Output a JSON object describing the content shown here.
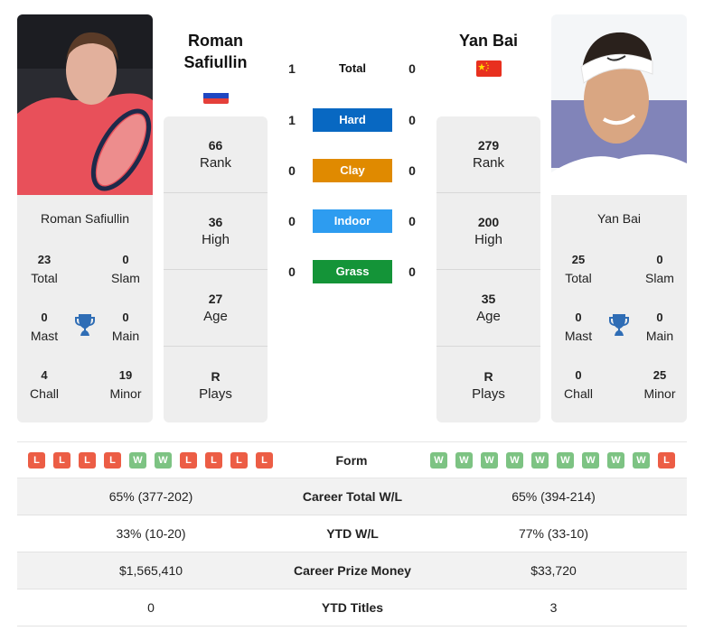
{
  "h2h": {
    "rows": [
      {
        "label": "Total",
        "p1": "1",
        "p2": "0",
        "color": ""
      },
      {
        "label": "Hard",
        "p1": "1",
        "p2": "0",
        "color": "#0868c2"
      },
      {
        "label": "Clay",
        "p1": "0",
        "p2": "0",
        "color": "#e08a00"
      },
      {
        "label": "Indoor",
        "p1": "0",
        "p2": "0",
        "color": "#2d9cf0"
      },
      {
        "label": "Grass",
        "p1": "0",
        "p2": "0",
        "color": "#149438"
      }
    ]
  },
  "player1": {
    "name_line1": "Roman",
    "name_line2": "Safiullin",
    "full_name": "Roman Safiullin",
    "flag": "russia-flag",
    "rank": {
      "value": "66",
      "label": "Rank"
    },
    "high": {
      "value": "36",
      "label": "High"
    },
    "age": {
      "value": "27",
      "label": "Age"
    },
    "plays": {
      "value": "R",
      "label": "Plays"
    },
    "titles": {
      "total": {
        "value": "23",
        "label": "Total"
      },
      "slam": {
        "value": "0",
        "label": "Slam"
      },
      "mast": {
        "value": "0",
        "label": "Mast"
      },
      "main": {
        "value": "0",
        "label": "Main"
      },
      "chall": {
        "value": "4",
        "label": "Chall"
      },
      "minor": {
        "value": "19",
        "label": "Minor"
      }
    },
    "form": [
      "L",
      "L",
      "L",
      "L",
      "W",
      "W",
      "L",
      "L",
      "L",
      "L"
    ]
  },
  "player2": {
    "name": "Yan Bai",
    "full_name": "Yan Bai",
    "flag": "china-flag",
    "rank": {
      "value": "279",
      "label": "Rank"
    },
    "high": {
      "value": "200",
      "label": "High"
    },
    "age": {
      "value": "35",
      "label": "Age"
    },
    "plays": {
      "value": "R",
      "label": "Plays"
    },
    "titles": {
      "total": {
        "value": "25",
        "label": "Total"
      },
      "slam": {
        "value": "0",
        "label": "Slam"
      },
      "mast": {
        "value": "0",
        "label": "Mast"
      },
      "main": {
        "value": "0",
        "label": "Main"
      },
      "chall": {
        "value": "0",
        "label": "Chall"
      },
      "minor": {
        "value": "25",
        "label": "Minor"
      }
    },
    "form": [
      "W",
      "W",
      "W",
      "W",
      "W",
      "W",
      "W",
      "W",
      "W",
      "L"
    ]
  },
  "form_label": "Form",
  "comparison": [
    {
      "label": "Career Total W/L",
      "p1": "65% (377-202)",
      "p2": "65% (394-214)"
    },
    {
      "label": "YTD W/L",
      "p1": "33% (10-20)",
      "p2": "77% (33-10)"
    },
    {
      "label": "Career Prize Money",
      "p1": "$1,565,410",
      "p2": "$33,720"
    },
    {
      "label": "YTD Titles",
      "p1": "0",
      "p2": "3"
    }
  ]
}
